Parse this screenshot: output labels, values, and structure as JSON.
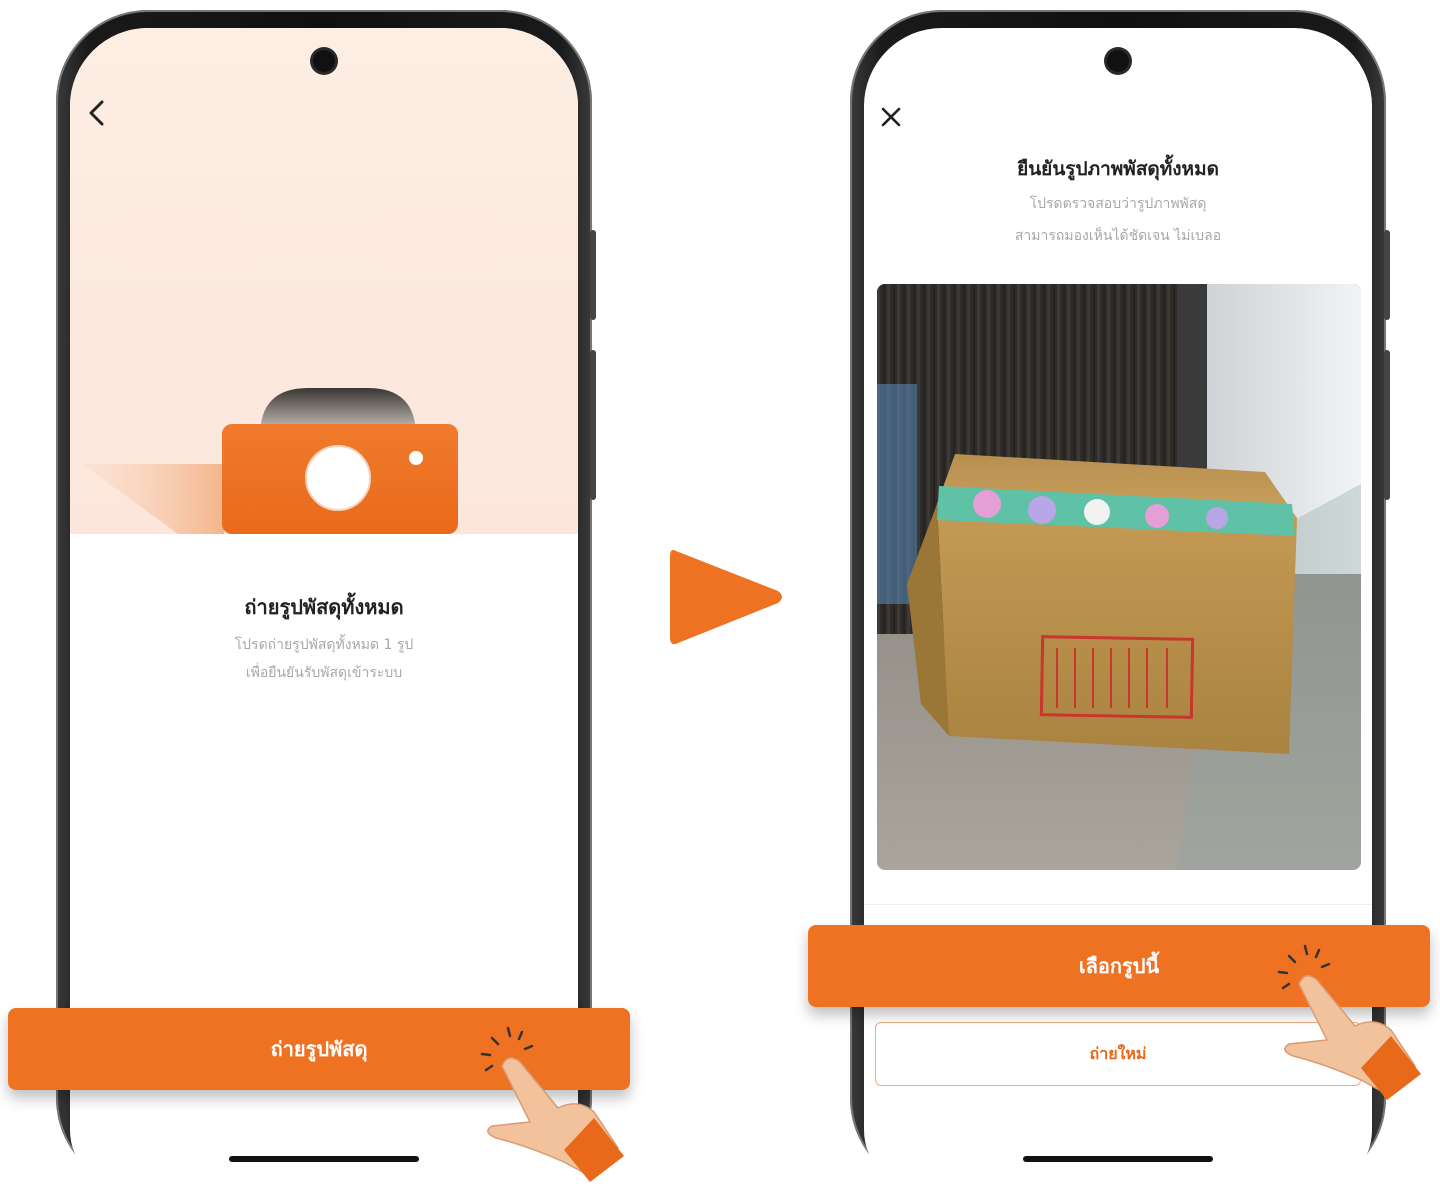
{
  "left_screen": {
    "title": "ถ่ายรูปพัสดุทั้งหมด",
    "subtitle_line1": "โปรดถ่ายรูปพัสดุทั้งหมด 1 รูป",
    "subtitle_line2": "เพื่อยืนยันรับพัสดุเข้าระบบ",
    "primary_button_label": "ถ่ายรูปพัสดุ"
  },
  "right_screen": {
    "title": "ยืนยันรูปภาพพัสดุทั้งหมด",
    "subtitle_line1": "โปรดตรวจสอบว่ารูปภาพพัสดุ",
    "subtitle_line2": "สามารถมองเห็นได้ชัดเจน ไม่เบลอ",
    "primary_button_label": "เลือกรูปนี้",
    "secondary_button_label": "ถ่ายใหม่"
  },
  "colors": {
    "accent": "#ef7223",
    "hero_bg": "#fdeee4",
    "muted_text": "#a8a8a8"
  },
  "icons": [
    "back-chevron-icon",
    "close-icon",
    "camera-illustration",
    "play-arrow-icon",
    "tap-hand-icon"
  ]
}
